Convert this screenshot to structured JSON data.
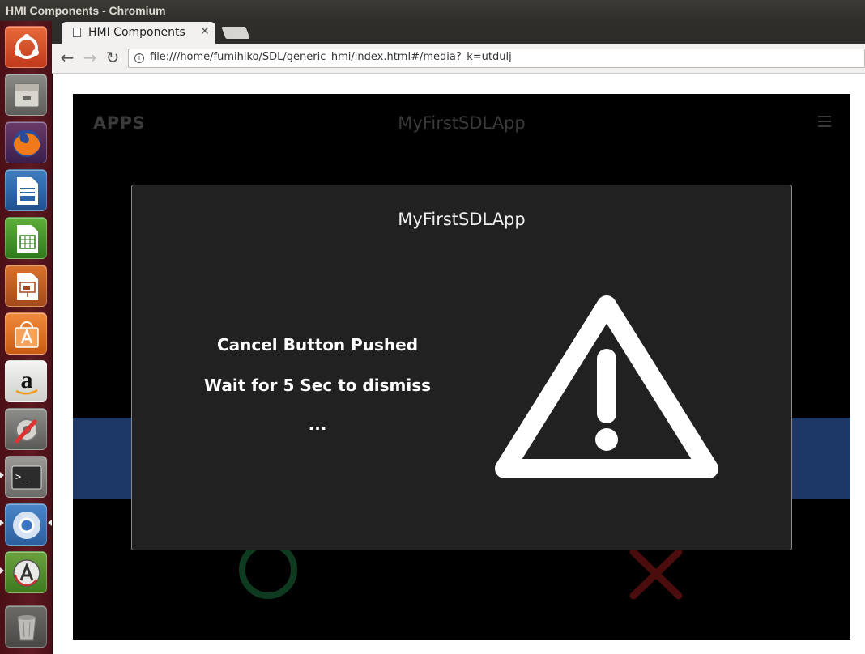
{
  "window": {
    "title": "HMI Components - Chromium"
  },
  "launcher": {
    "items": [
      {
        "name": "ubuntu-dash-icon"
      },
      {
        "name": "files-icon"
      },
      {
        "name": "firefox-icon"
      },
      {
        "name": "libreoffice-writer-icon"
      },
      {
        "name": "libreoffice-calc-icon"
      },
      {
        "name": "libreoffice-impress-icon"
      },
      {
        "name": "software-center-icon"
      },
      {
        "name": "amazon-icon"
      },
      {
        "name": "system-settings-icon"
      },
      {
        "name": "terminal-icon"
      },
      {
        "name": "chromium-icon"
      },
      {
        "name": "software-updater-icon"
      },
      {
        "name": "trash-icon"
      }
    ]
  },
  "browser": {
    "tab": {
      "title": "HMI Components",
      "close_glyph": "✕"
    },
    "nav": {
      "back_glyph": "←",
      "forward_glyph": "→",
      "reload_glyph": "↻"
    },
    "url": "file:///home/fumihiko/SDL/generic_hmi/index.html#/media?_k=utdulj",
    "info_glyph": "i"
  },
  "hmi": {
    "apps_label": "APPS",
    "app_name": "MyFirstSDLApp",
    "colors": {
      "background": "#000000",
      "band": "#1d3766",
      "ok": "#0e3a20",
      "cancel": "#4a0c0c"
    }
  },
  "alert": {
    "title": "MyFirstSDLApp",
    "line1": "Cancel Button Pushed",
    "line2": "Wait for 5 Sec to dismiss",
    "line3": "...",
    "icon": "warning-icon",
    "colors": {
      "background": "#212121",
      "icon": "#ffffff"
    }
  }
}
